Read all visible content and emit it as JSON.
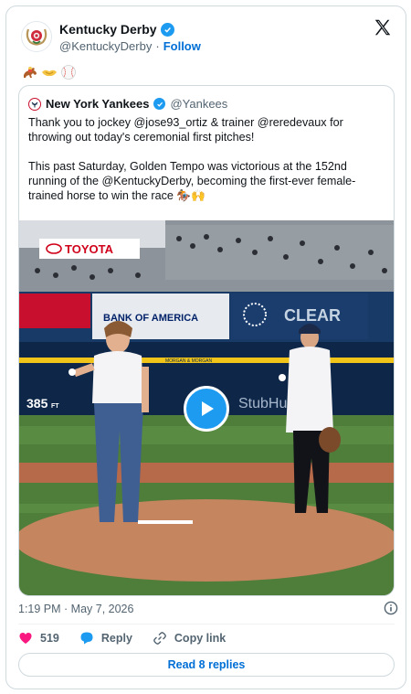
{
  "author": {
    "name": "Kentucky Derby",
    "handle": "@KentuckyDerby",
    "separator": "·",
    "follow_label": "Follow"
  },
  "post": {
    "emojis": [
      "horse-racing-emoji",
      "handshake-emoji",
      "baseball-emoji"
    ]
  },
  "quoted": {
    "name": "New York Yankees",
    "handle": "@Yankees",
    "paragraph1": "Thank you to jockey @jose93_ortiz & trainer @reredevaux for throwing out today's ceremonial first pitches!",
    "paragraph2": "This past Saturday, Golden Tempo was victorious at the 152nd running of the @KentuckyDerby, becoming the first-ever female-trained horse to win the race 🏇🙌",
    "media": {
      "signs": {
        "toyota": "TOYOTA",
        "bank": "BANK OF AMERICA",
        "clear": "CLEAR",
        "stubhub": "StubHub",
        "distance": "385",
        "distance_unit": "FT",
        "sponsor_strip": "MORGAN & MORGAN"
      }
    }
  },
  "meta": {
    "timestamp": "1:19 PM · May 7, 2026"
  },
  "actions": {
    "like_count": "519",
    "reply_label": "Reply",
    "copy_label": "Copy link",
    "read_replies_label": "Read 8 replies"
  },
  "colors": {
    "accent": "#1d9bf0",
    "link": "#006fd6",
    "like": "#f91880",
    "muted": "#536471"
  }
}
